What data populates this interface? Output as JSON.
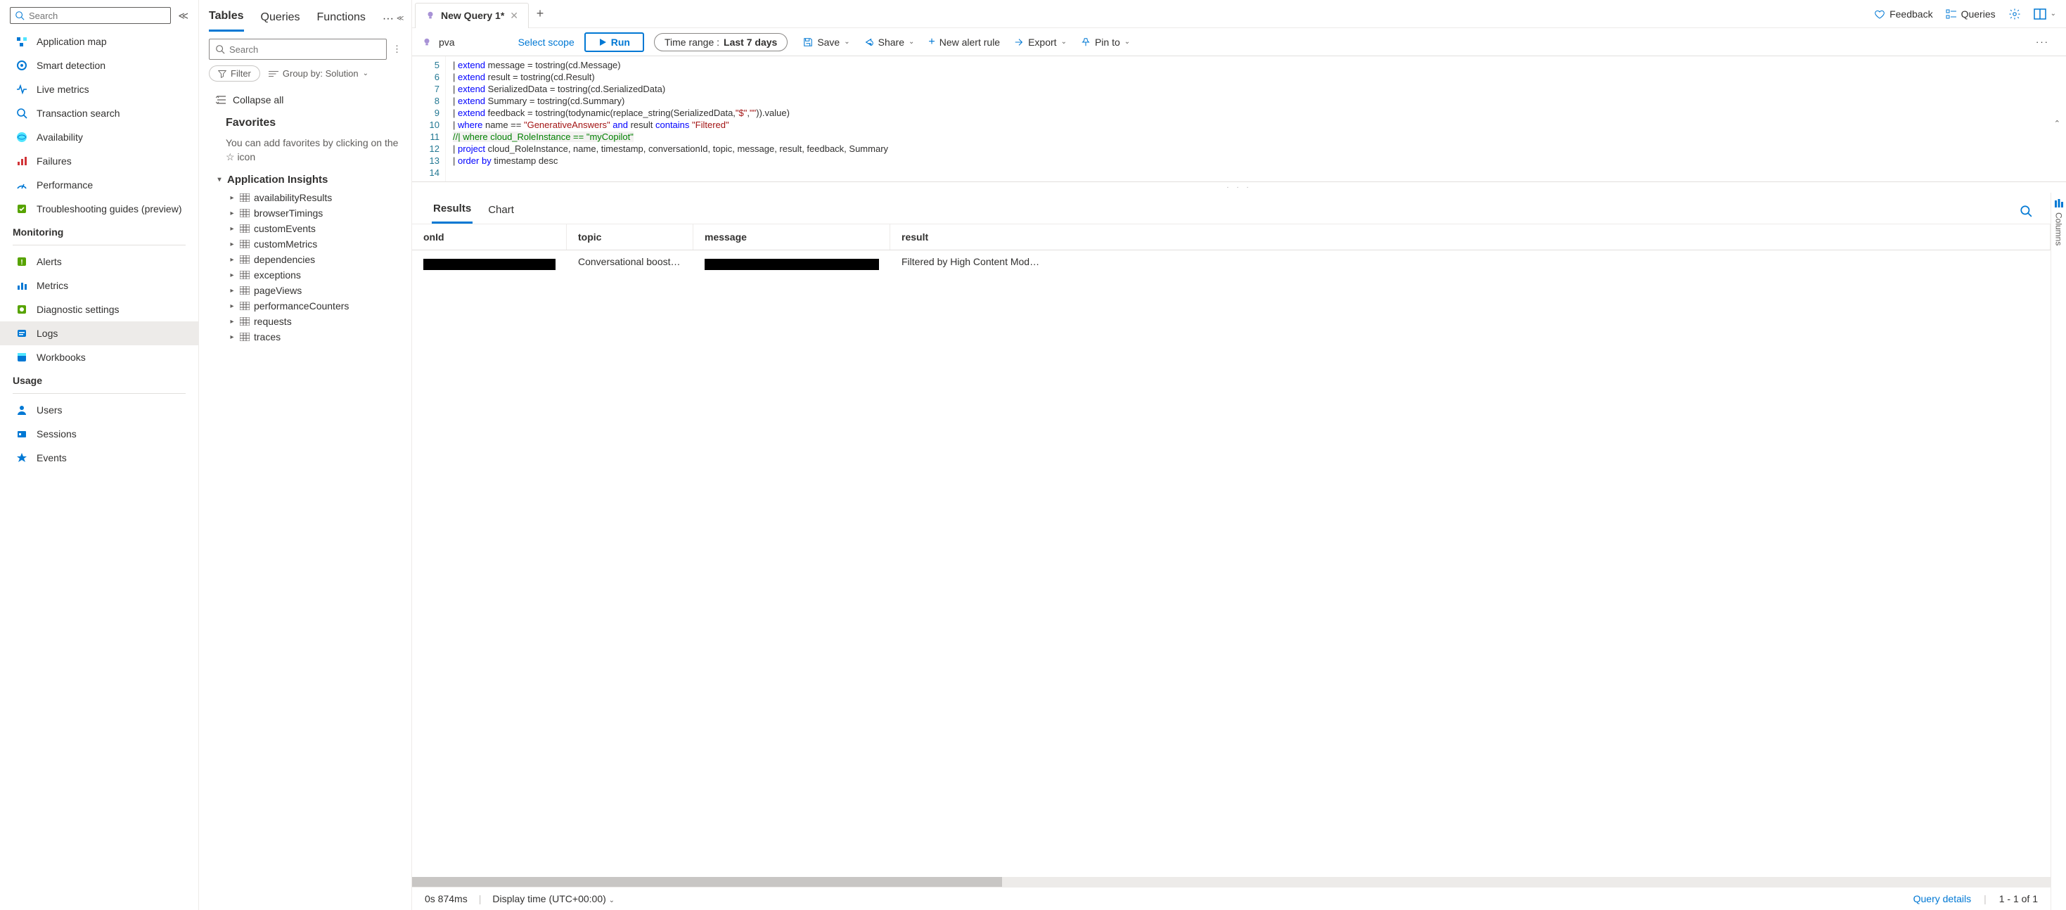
{
  "sidebar": {
    "search_placeholder": "Search",
    "groups": [
      {
        "title": null,
        "items": [
          {
            "label": "Application map"
          },
          {
            "label": "Smart detection"
          },
          {
            "label": "Live metrics"
          },
          {
            "label": "Transaction search"
          },
          {
            "label": "Availability"
          },
          {
            "label": "Failures"
          },
          {
            "label": "Performance"
          },
          {
            "label": "Troubleshooting guides (preview)"
          }
        ]
      },
      {
        "title": "Monitoring",
        "items": [
          {
            "label": "Alerts"
          },
          {
            "label": "Metrics"
          },
          {
            "label": "Diagnostic settings"
          },
          {
            "label": "Logs",
            "active": true
          },
          {
            "label": "Workbooks"
          }
        ]
      },
      {
        "title": "Usage",
        "items": [
          {
            "label": "Users"
          },
          {
            "label": "Sessions"
          },
          {
            "label": "Events"
          }
        ]
      }
    ]
  },
  "schema": {
    "tabs": [
      "Tables",
      "Queries",
      "Functions"
    ],
    "active_tab": "Tables",
    "search_placeholder": "Search",
    "filter_label": "Filter",
    "groupby_label": "Group by: Solution",
    "collapse_all": "Collapse all",
    "favorites_title": "Favorites",
    "favorites_desc": "You can add favorites by clicking on the ☆ icon",
    "group": "Application Insights",
    "tables": [
      "availabilityResults",
      "browserTimings",
      "customEvents",
      "customMetrics",
      "dependencies",
      "exceptions",
      "pageViews",
      "performanceCounters",
      "requests",
      "traces"
    ]
  },
  "main": {
    "tab_title": "New Query 1*",
    "top_actions": {
      "feedback": "Feedback",
      "queries": "Queries"
    },
    "scope_name": "pva",
    "select_scope": "Select scope",
    "run": "Run",
    "time_range_label": "Time range :",
    "time_range_value": "Last 7 days",
    "toolbar": {
      "save": "Save",
      "share": "Share",
      "alert": "New alert rule",
      "export": "Export",
      "pin": "Pin to"
    },
    "code_lines": [
      {
        "n": 5,
        "html": "| <span class='kw'>extend</span> message = tostring(cd.Message)"
      },
      {
        "n": 6,
        "html": "| <span class='kw'>extend</span> result = tostring(cd.Result)"
      },
      {
        "n": 7,
        "html": "| <span class='kw'>extend</span> SerializedData = tostring(cd.SerializedData)"
      },
      {
        "n": 8,
        "html": "| <span class='kw'>extend</span> Summary = tostring(cd.Summary)"
      },
      {
        "n": 9,
        "html": "| <span class='kw'>extend</span> feedback = tostring(todynamic(replace_string(SerializedData,<span class='str'>\"$\"</span>,<span class='str'>\"\"</span>)).value)"
      },
      {
        "n": 10,
        "html": "| <span class='kw'>where</span> name == <span class='str'>\"GenerativeAnswers\"</span> <span class='kw'>and</span> result <span class='kw'>contains</span> <span class='str'>\"Filtered\"</span>"
      },
      {
        "n": 11,
        "html": "<span class='cmt'>//| where cloud_RoleInstance == \"myCopilot\"</span>"
      },
      {
        "n": 12,
        "html": "| <span class='kw'>project</span> cloud_RoleInstance, name, timestamp, conversationId, topic, message, result, feedback, Summary"
      },
      {
        "n": 13,
        "html": "| <span class='kw'>order by</span> timestamp desc"
      },
      {
        "n": 14,
        "html": ""
      }
    ],
    "results": {
      "tabs": [
        "Results",
        "Chart"
      ],
      "columns_rail": "Columns",
      "headers": {
        "onid": "onId",
        "topic": "topic",
        "message": "message",
        "result": "result"
      },
      "row": {
        "topic": "Conversational boosting",
        "result": "Filtered by High Content Mod…"
      }
    },
    "status": {
      "time": "0s 874ms",
      "display_time": "Display time (UTC+00:00)",
      "query_details": "Query details",
      "paging": "1 - 1 of 1"
    }
  }
}
